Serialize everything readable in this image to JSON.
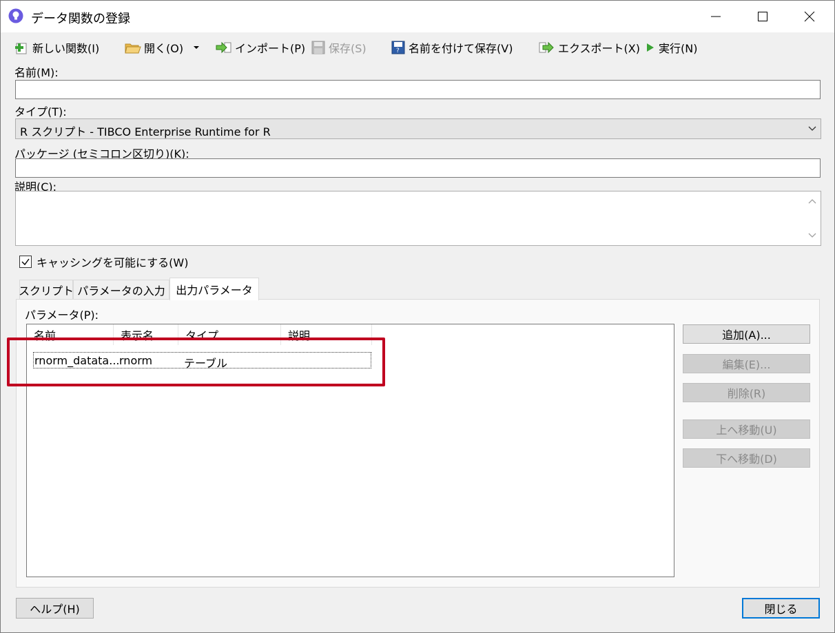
{
  "window": {
    "title": "データ関数の登録"
  },
  "toolbar": {
    "new_function": "新しい関数(I)",
    "open": "開く(O)",
    "import": "インポート(P)",
    "save": "保存(S)",
    "save_as": "名前を付けて保存(V)",
    "export": "エクスポート(X)",
    "run": "実行(N)"
  },
  "form": {
    "name_label": "名前(M):",
    "name_value": "",
    "type_label": "タイプ(T):",
    "type_value": "R スクリプト - TIBCO Enterprise Runtime for R",
    "packages_label": "パッケージ (セミコロン区切り)(K):",
    "packages_value": "",
    "description_label": "説明(C):",
    "description_value": "",
    "caching_label": "キャッシングを可能にする(W)",
    "caching_checked": true
  },
  "tabs": [
    {
      "label": "スクリプト",
      "active": false
    },
    {
      "label": "パラメータの入力",
      "active": false
    },
    {
      "label": "出力パラメータ",
      "active": true
    }
  ],
  "output_params": {
    "list_label": "パラメータ(P):",
    "columns": [
      "名前",
      "表示名",
      "タイプ",
      "説明"
    ],
    "rows": [
      {
        "name": "rnorm_datata...",
        "display_name": "rnorm",
        "type": "テーブル",
        "description": ""
      }
    ],
    "buttons": {
      "add": "追加(A)...",
      "edit": "編集(E)...",
      "delete": "削除(R)",
      "move_up": "上へ移動(U)",
      "move_down": "下へ移動(D)"
    }
  },
  "footer": {
    "help": "ヘルプ(H)",
    "close": "閉じる"
  },
  "colors": {
    "highlight": "#c00020",
    "default_button_border": "#0078d7"
  }
}
